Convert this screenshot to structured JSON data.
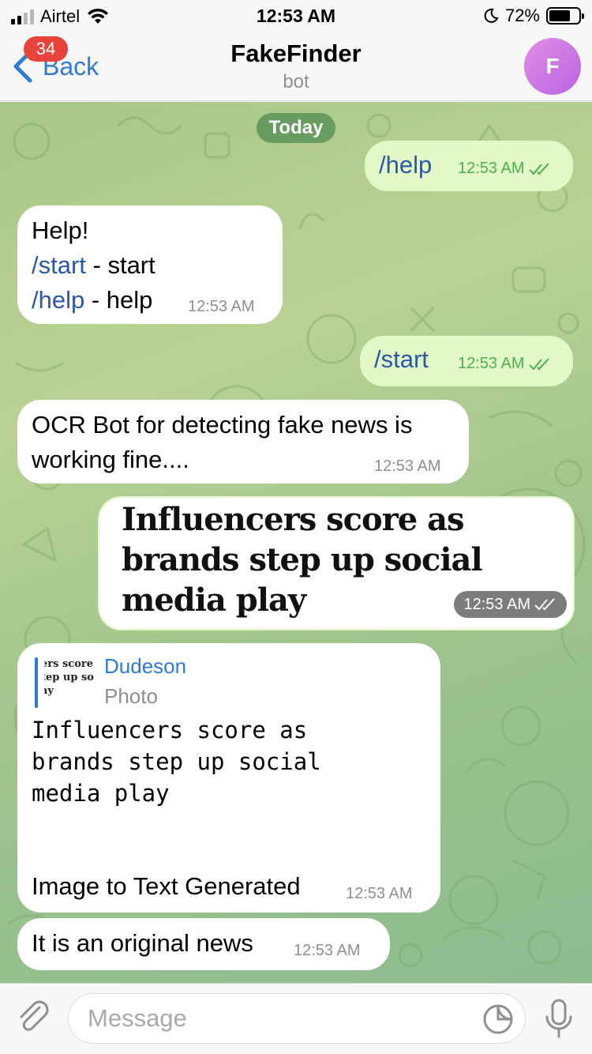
{
  "status": {
    "carrier": "Airtel",
    "time": "12:53 AM",
    "battery": "72%",
    "battery_level": 0.72
  },
  "nav": {
    "back_label": "Back",
    "unread_count": "34",
    "title": "FakeFinder",
    "subtitle": "bot",
    "avatar_letter": "F",
    "avatar_color": "#c77be4"
  },
  "chat": {
    "date_label": "Today",
    "messages": [
      {
        "dir": "out",
        "text": "/help",
        "time": "12:53 AM"
      },
      {
        "dir": "in",
        "lines": [
          {
            "cmd": "",
            "rest": "Help!"
          },
          {
            "cmd": "/start",
            "rest": " - start"
          },
          {
            "cmd": "/help",
            "rest": " - help"
          }
        ],
        "time": "12:53 AM"
      },
      {
        "dir": "out",
        "text": "/start",
        "time": "12:53 AM"
      },
      {
        "dir": "in",
        "lines": [
          "OCR Bot for detecting fake news is",
          "working fine...."
        ],
        "time": "12:53 AM"
      },
      {
        "dir": "out",
        "type": "photo",
        "headline": [
          "Influencers score as",
          "brands step up social",
          "media play"
        ],
        "time": "12:53 AM"
      },
      {
        "dir": "in",
        "reply_to": {
          "name": "Dudeson",
          "kind": "Photo",
          "thumb": [
            "ers score",
            "tep up so",
            "ay"
          ]
        },
        "ocr_text": "Influencers score as\nbrands step up social\nmedia play",
        "caption": "Image to Text Generated",
        "time": "12:53 AM"
      },
      {
        "dir": "in",
        "text": "It is an original news",
        "time": "12:53 AM"
      }
    ]
  },
  "input": {
    "placeholder": "Message",
    "value": ""
  },
  "colors": {
    "accent": "#2e7ad6",
    "badge": "#e8433a",
    "out_bubble": "#e2f8c6",
    "read_tick": "#4fae4e"
  },
  "icons": [
    "signal-icon",
    "wifi-icon",
    "moon-icon",
    "battery-icon",
    "back-chevron-icon",
    "double-check-icon",
    "attachment-icon",
    "sticker-icon",
    "microphone-icon"
  ]
}
